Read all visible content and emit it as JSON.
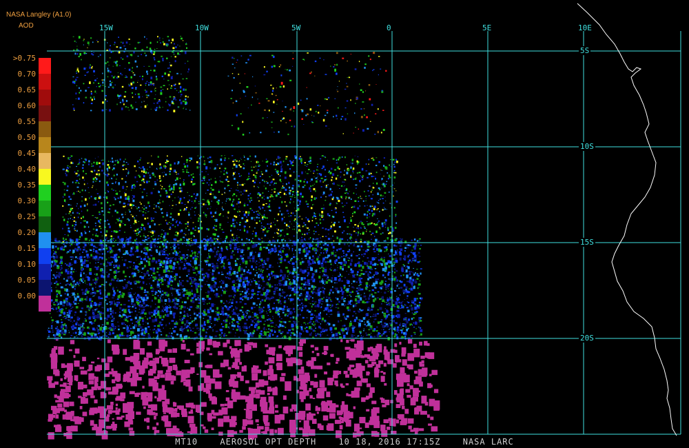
{
  "header": {
    "source": "NASA Langley (A1.0)",
    "product": "AOD"
  },
  "legend": {
    "levels": [
      {
        "label": ">0.75",
        "color": "#ff1a1a"
      },
      {
        "label": "0.70",
        "color": "#cc1010"
      },
      {
        "label": "0.65",
        "color": "#a00c0c"
      },
      {
        "label": "0.60",
        "color": "#781010"
      },
      {
        "label": "0.55",
        "color": "#8a5a10"
      },
      {
        "label": "0.50",
        "color": "#b8861c"
      },
      {
        "label": "0.45",
        "color": "#e8b860"
      },
      {
        "label": "0.40",
        "color": "#f8f820"
      },
      {
        "label": "0.35",
        "color": "#20d020"
      },
      {
        "label": "0.30",
        "color": "#18a018"
      },
      {
        "label": "0.25",
        "color": "#106010"
      },
      {
        "label": "0.20",
        "color": "#2090f0"
      },
      {
        "label": "0.15",
        "color": "#1040f0"
      },
      {
        "label": "0.10",
        "color": "#1020b0"
      },
      {
        "label": "0.05",
        "color": "#0c1470"
      },
      {
        "label": "0.00",
        "color": "#c0309a"
      }
    ]
  },
  "lon_labels": [
    "15W",
    "10W",
    "5W",
    "0",
    "5E",
    "10E"
  ],
  "lat_labels": [
    "5S",
    "10S",
    "15S",
    "20S"
  ],
  "caption": {
    "sat": "MT10",
    "product": "AEROSOL OPT DEPTH",
    "datetime": "10 18, 2016 17:15Z",
    "org": "NASA LARC"
  },
  "colors": {
    "grid": "#40e0e0",
    "coast": "#ffffff",
    "legend_text": "#f0a040"
  }
}
